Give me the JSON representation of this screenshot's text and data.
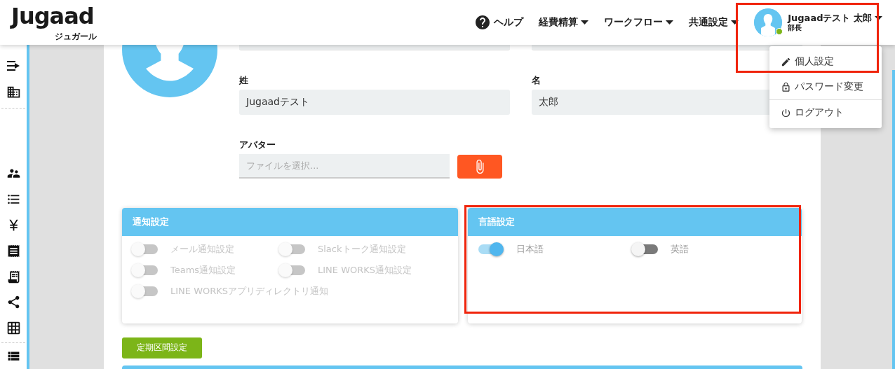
{
  "logo": {
    "name": "Jugaad",
    "subtitle": "ジュガール"
  },
  "nav": [
    {
      "label": "ヘルプ",
      "kind": "help"
    },
    {
      "label": "経費精算",
      "kind": "menu"
    },
    {
      "label": "ワークフロー",
      "kind": "menu"
    },
    {
      "label": "共通設定",
      "kind": "menu"
    }
  ],
  "user": {
    "name": "Jugaadテスト 太郎",
    "role": "部長",
    "online": true
  },
  "user_menu": [
    {
      "label": "個人設定",
      "kind": "edit",
      "highlighted": true
    },
    {
      "label": "パスワード変更",
      "kind": "lock",
      "highlighted": false
    },
    {
      "label": "ログアウト",
      "kind": "power",
      "highlighted": false
    }
  ],
  "profile": {
    "last_name": {
      "label": "姓",
      "value": "Jugaadテスト"
    },
    "first_name": {
      "label": "名",
      "value": "太郎"
    },
    "avatar": {
      "label": "アバター",
      "placeholder": "ファイルを選択..."
    }
  },
  "notification_panel": {
    "title": "通知設定",
    "toggles": [
      {
        "label": "メール通知設定",
        "on": false,
        "disabled": true
      },
      {
        "label": "Slackトーク通知設定",
        "on": false,
        "disabled": true
      },
      {
        "label": "Teams通知設定",
        "on": false,
        "disabled": true
      },
      {
        "label": "LINE WORKS通知設定",
        "on": false,
        "disabled": true
      },
      {
        "label": "LINE WORKSアプリディレクトリ通知",
        "on": false,
        "disabled": true
      }
    ]
  },
  "language_panel": {
    "title": "言語設定",
    "highlighted": true,
    "toggles": [
      {
        "label": "日本語",
        "on": true,
        "disabled": false
      },
      {
        "label": "英語",
        "on": false,
        "disabled": false
      }
    ]
  },
  "commute_button": "定期区間設定"
}
